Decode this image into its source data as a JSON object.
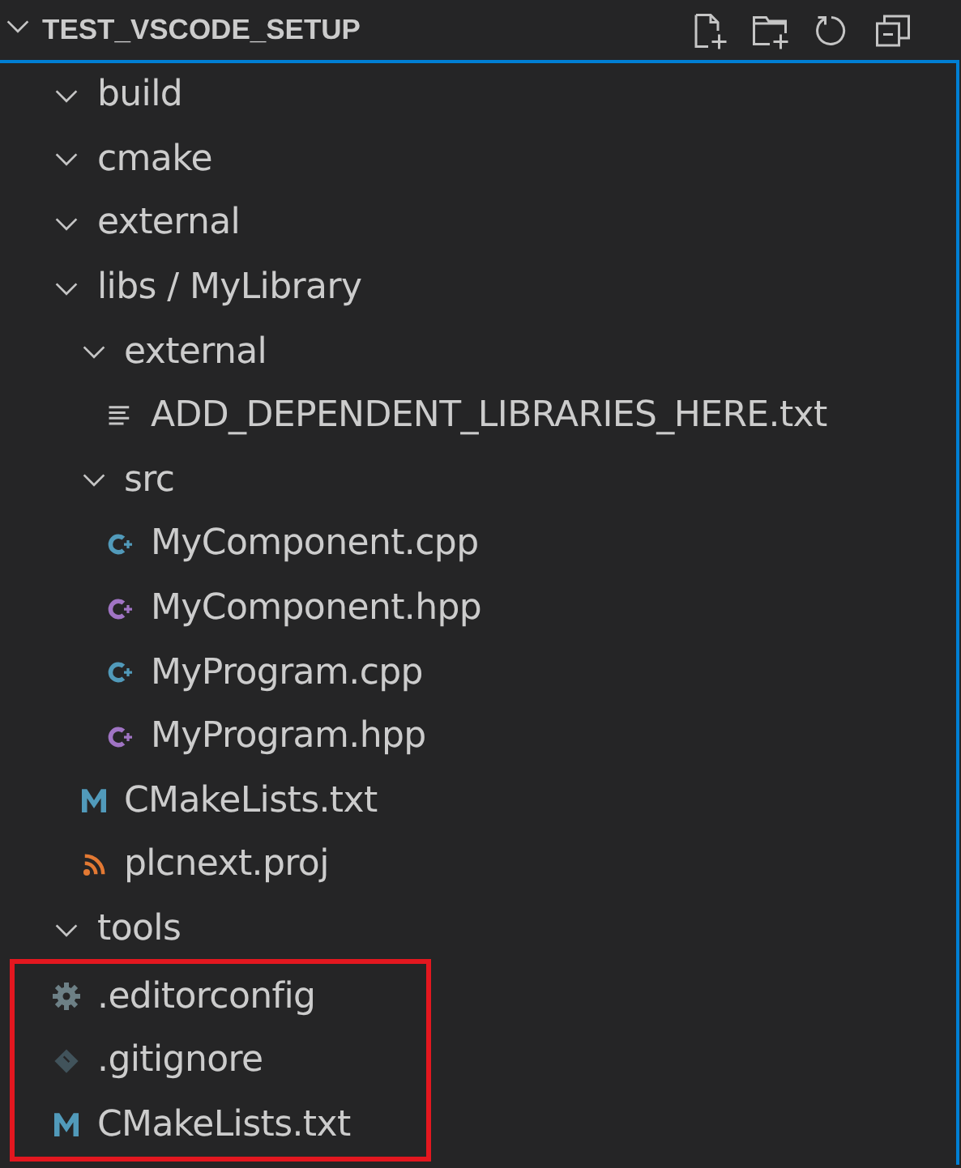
{
  "section": {
    "title": "TEST_VSCODE_SETUP",
    "expanded": true
  },
  "tree": [
    {
      "kind": "folder",
      "label": "build",
      "expanded": true,
      "highlighted": false
    },
    {
      "kind": "folder",
      "label": "cmake",
      "expanded": true,
      "highlighted": false
    },
    {
      "kind": "folder",
      "label": "external",
      "expanded": true,
      "highlighted": false
    },
    {
      "kind": "folder",
      "label": "libs / MyLibrary",
      "expanded": true,
      "highlighted": false,
      "children": [
        {
          "kind": "folder",
          "label": "external",
          "expanded": true,
          "highlighted": false,
          "children": [
            {
              "kind": "text",
              "label": "ADD_DEPENDENT_LIBRARIES_HERE.txt",
              "highlighted": false
            }
          ]
        },
        {
          "kind": "folder",
          "label": "src",
          "expanded": true,
          "highlighted": false,
          "children": [
            {
              "kind": "cpp",
              "label": "MyComponent.cpp",
              "highlighted": false
            },
            {
              "kind": "hpp",
              "label": "MyComponent.hpp",
              "highlighted": false
            },
            {
              "kind": "cpp",
              "label": "MyProgram.cpp",
              "highlighted": false
            },
            {
              "kind": "hpp",
              "label": "MyProgram.hpp",
              "highlighted": false
            }
          ]
        },
        {
          "kind": "cmake",
          "label": "CMakeLists.txt",
          "highlighted": false
        },
        {
          "kind": "feed",
          "label": "plcnext.proj",
          "highlighted": false
        }
      ]
    },
    {
      "kind": "folder",
      "label": "tools",
      "expanded": true,
      "highlighted": false
    },
    {
      "kind": "config",
      "label": ".editorconfig",
      "highlighted": true
    },
    {
      "kind": "git",
      "label": ".gitignore",
      "highlighted": true
    },
    {
      "kind": "cmake",
      "label": "CMakeLists.txt",
      "highlighted": true
    }
  ]
}
